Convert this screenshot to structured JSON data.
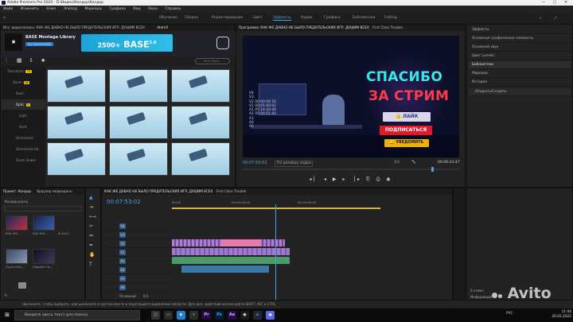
{
  "window": {
    "title": "Adobe Premiere Pro 2020 - D:\\Видео\\Кондор\\Кондор"
  },
  "menu": [
    "Файл",
    "Изменить",
    "Клип",
    "Эпизод",
    "Маркеры",
    "Графика",
    "Вид",
    "Окно",
    "Справка"
  ],
  "workspaces": {
    "items": [
      "Обучение",
      "Сборка",
      "Редактирование",
      "Цвет",
      "Эффекты",
      "Аудио",
      "Графика",
      "Библиотеки",
      "Editing"
    ],
    "active": "Эффекты"
  },
  "source_tabs": "Исх. видеозапись: КАК ЖЕ ДАВНО НЕ БЫЛО ПРЕДАТЕЛЬСКИХ ИГР, ДУШИМ ВСЕХ",
  "source_tabs_right": "AtomX",
  "atomx": {
    "title": "BASE Montage Library",
    "vendor": "by lonesstudio",
    "banner_count": "2500+",
    "banner_name": "BASE",
    "banner_version": "2.0",
    "search_placeholder": "Find items",
    "sidebar": [
      {
        "label": "Transitions",
        "badge": "72"
      },
      {
        "label": "Zoom",
        "badge": "16"
      },
      {
        "label": "Basic",
        "badge": ""
      },
      {
        "label": "Optic",
        "badge": "2"
      },
      {
        "label": "Light",
        "badge": ""
      },
      {
        "label": "Hard",
        "badge": ""
      },
      {
        "label": "Directional",
        "badge": ""
      },
      {
        "label": "Directional Hit",
        "badge": ""
      },
      {
        "label": "Zoom Shake",
        "badge": ""
      }
    ]
  },
  "program": {
    "tab": "Программа: КАК ЖЕ ДАВНО НЕ БЫЛО ПРЕДАТЕЛЬСКИХ ИГР, ДУШИМ ВСЕХ",
    "tab_extra": "First Class Trouble",
    "headline1": "СПАСИБО",
    "headline2": "ЗА СТРИМ",
    "btn_like": "ЛАЙК",
    "btn_sub": "ПОДПИСАТЬСЯ",
    "btn_notify": "УВЕДОМИТЬ",
    "overlay_tc": "V4\nV3\nV2 00:00:00:16\nV1 00:05:00:02\nA1 05:14:20:40\nA2 00:00:01:40\nA3\nA4\nA5",
    "timecode": "00:07:53:02",
    "fit": "По размеру кадра",
    "ratio": "1/1",
    "duration": "00:08:43:47",
    "transport": "◂▏ ◂ ▶ ▸ ▕▸ ⎘ ⎙ ◉"
  },
  "effects_panel": {
    "items": [
      "Эффекты",
      "Основные графические элементы",
      "Основной звук",
      "Цвет Lumetri",
      "Библиотеки",
      "Маркеры",
      "История"
    ],
    "selected": "Библиотеки",
    "history_item": "Открыть/Создать"
  },
  "project": {
    "tab": "Проект: Кондор",
    "tab2": "Браузер медиаданн",
    "file": "Кондор.prproj",
    "items": [
      {
        "name": "КАК ЖЕ...",
        "dur": "8:43:47"
      },
      {
        "name": "КАК ЖЕ...",
        "dur": "5:43:47"
      },
      {
        "name": "Соуса Pres...",
        "dur": ""
      },
      {
        "name": "Недайте 3к...",
        "dur": ""
      }
    ]
  },
  "timeline": {
    "tab": "КАК ЖЕ ДАВНО НЕ БЫЛО ПРЕДАТЕЛЬСКИХ ИГР, ДУШИМ ВСЕХ",
    "tab_extra": "First Class Trouble",
    "timecode": "00:07:53:02",
    "ruler": [
      "00:00",
      "00:05:00:00",
      "00:10:00:00"
    ],
    "video_tracks": [
      "V4",
      "V3",
      "V2",
      "V1"
    ],
    "audio_tracks": [
      "A1",
      "A2",
      "A3",
      "A4",
      "A5"
    ],
    "master": "Основной",
    "master_val": "0,0"
  },
  "history": {
    "label": "0 отмен",
    "info": "Информация"
  },
  "status": "Щелкните, чтобы выбрать, или щелкните в пустом месте и перетащите выделение области. Для доп. действий используйте SHIFT, ALT и CTRL.",
  "taskbar": {
    "search_placeholder": "Введите здесь текст для поиска",
    "time": "11:44",
    "date": "26.02.2022",
    "lang": "РУС"
  },
  "watermark": "Avito"
}
